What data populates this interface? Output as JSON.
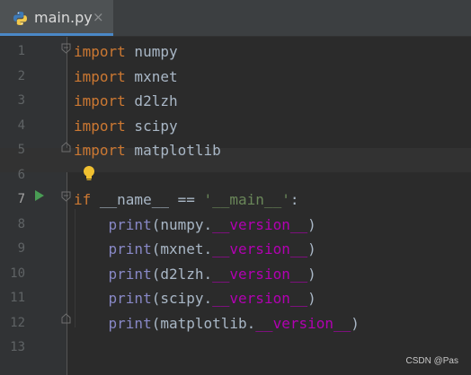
{
  "tab": {
    "label": "main.py",
    "close": "×"
  },
  "lines": [
    {
      "num": "1",
      "tokens": [
        {
          "t": "import",
          "c": "kw"
        },
        {
          "t": " numpy",
          "c": ""
        }
      ]
    },
    {
      "num": "2",
      "tokens": [
        {
          "t": "import",
          "c": "kw"
        },
        {
          "t": " mxnet",
          "c": ""
        }
      ]
    },
    {
      "num": "3",
      "tokens": [
        {
          "t": "import",
          "c": "kw"
        },
        {
          "t": " d2lzh",
          "c": ""
        }
      ]
    },
    {
      "num": "4",
      "tokens": [
        {
          "t": "import",
          "c": "kw"
        },
        {
          "t": " scipy",
          "c": ""
        }
      ]
    },
    {
      "num": "5",
      "tokens": [
        {
          "t": "import",
          "c": "kw"
        },
        {
          "t": " matplotlib",
          "c": ""
        }
      ]
    },
    {
      "num": "6",
      "tokens": []
    },
    {
      "num": "7",
      "tokens": [
        {
          "t": "if",
          "c": "kw"
        },
        {
          "t": " __name__ == ",
          "c": ""
        },
        {
          "t": "'__main__'",
          "c": "str"
        },
        {
          "t": ":",
          "c": ""
        }
      ]
    },
    {
      "num": "8",
      "tokens": [
        {
          "t": "    ",
          "c": ""
        },
        {
          "t": "print",
          "c": "fn"
        },
        {
          "t": "(numpy.",
          "c": ""
        },
        {
          "t": "__version__",
          "c": "dunder"
        },
        {
          "t": ")",
          "c": ""
        }
      ]
    },
    {
      "num": "9",
      "tokens": [
        {
          "t": "    ",
          "c": ""
        },
        {
          "t": "print",
          "c": "fn"
        },
        {
          "t": "(mxnet.",
          "c": ""
        },
        {
          "t": "__version__",
          "c": "dunder"
        },
        {
          "t": ")",
          "c": ""
        }
      ]
    },
    {
      "num": "10",
      "tokens": [
        {
          "t": "    ",
          "c": ""
        },
        {
          "t": "print",
          "c": "fn"
        },
        {
          "t": "(d2lzh.",
          "c": ""
        },
        {
          "t": "__version__",
          "c": "dunder"
        },
        {
          "t": ")",
          "c": ""
        }
      ]
    },
    {
      "num": "11",
      "tokens": [
        {
          "t": "    ",
          "c": ""
        },
        {
          "t": "print",
          "c": "fn"
        },
        {
          "t": "(scipy.",
          "c": ""
        },
        {
          "t": "__version__",
          "c": "dunder"
        },
        {
          "t": ")",
          "c": ""
        }
      ]
    },
    {
      "num": "12",
      "tokens": [
        {
          "t": "    ",
          "c": ""
        },
        {
          "t": "print",
          "c": "fn"
        },
        {
          "t": "(matplotlib.",
          "c": ""
        },
        {
          "t": "__version__",
          "c": "dunder"
        },
        {
          "t": ")",
          "c": ""
        }
      ]
    },
    {
      "num": "13",
      "tokens": []
    }
  ],
  "current_line": "7",
  "watermark": "CSDN @Pas",
  "colors": {
    "keyword": "#cc7832",
    "string": "#6a8759",
    "builtin": "#8888c6",
    "dunder": "#b200b2",
    "text": "#a9b7c6",
    "run": "#499c54",
    "bulb": "#f0c030",
    "tab_underline": "#4a88c7"
  },
  "icons": {
    "tab_file": "python-file-icon",
    "run": "run-icon",
    "fold": "fold-icon",
    "bulb": "intention-bulb-icon"
  }
}
